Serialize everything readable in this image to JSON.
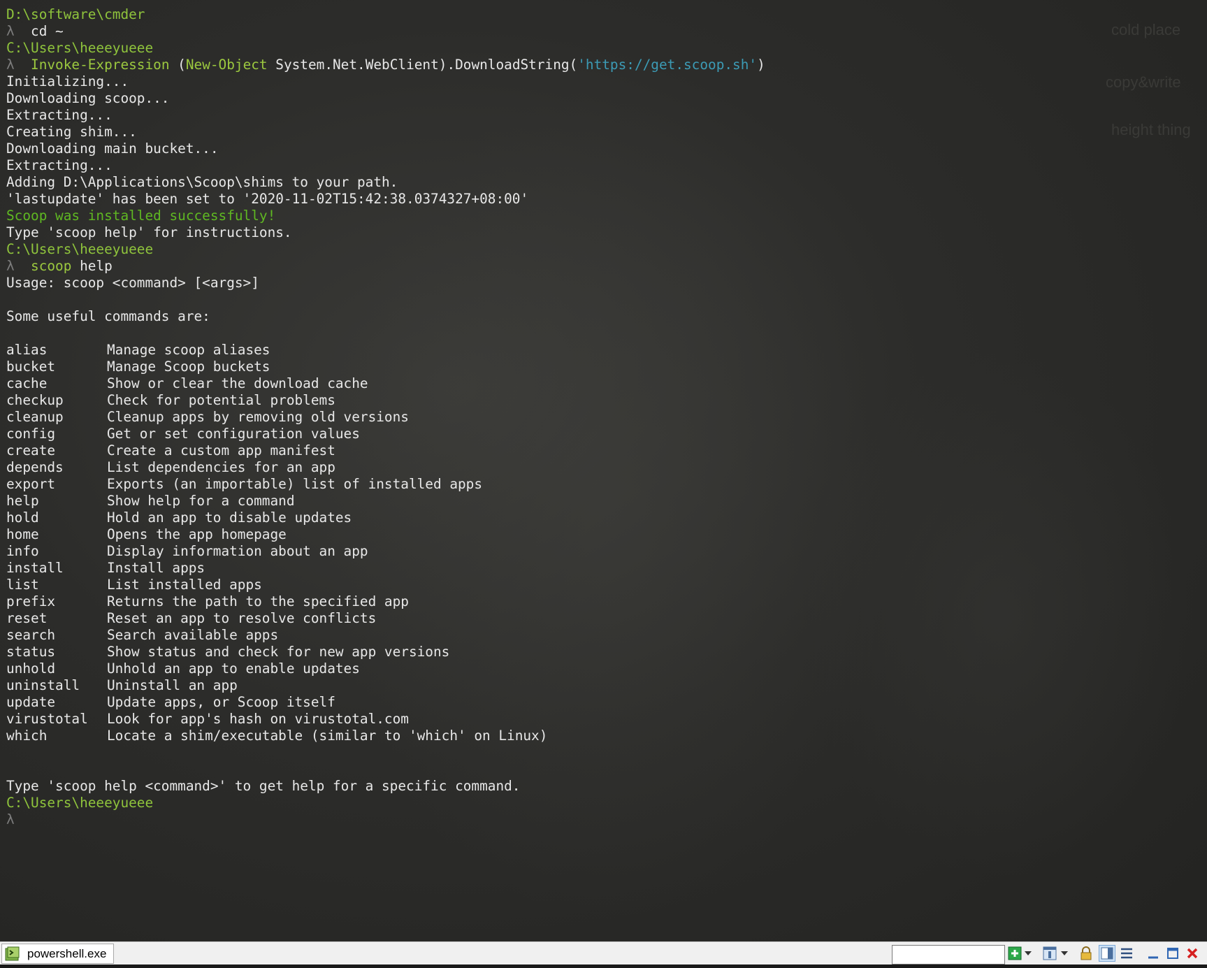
{
  "terminal": {
    "lines": [
      {
        "segments": [
          {
            "t": "D:\\software\\cmder",
            "c": "path"
          }
        ]
      },
      {
        "segments": [
          {
            "t": "λ",
            "c": "lambda"
          },
          {
            "t": "  cd ~",
            "c": ""
          }
        ]
      },
      {
        "segments": [
          {
            "t": "C:\\Users\\heeeyueee",
            "c": "path"
          }
        ]
      },
      {
        "segments": [
          {
            "t": "λ",
            "c": "lambda"
          },
          {
            "t": "  Invoke-Expression",
            "c": "kw"
          },
          {
            "t": " (",
            "c": ""
          },
          {
            "t": "New-Object",
            "c": "kw"
          },
          {
            "t": " System.Net.WebClient).DownloadString(",
            "c": ""
          },
          {
            "t": "'https://get.scoop.sh'",
            "c": "str"
          },
          {
            "t": ")",
            "c": ""
          }
        ]
      },
      {
        "segments": [
          {
            "t": "Initializing...",
            "c": ""
          }
        ]
      },
      {
        "segments": [
          {
            "t": "Downloading scoop...",
            "c": ""
          }
        ]
      },
      {
        "segments": [
          {
            "t": "Extracting...",
            "c": ""
          }
        ]
      },
      {
        "segments": [
          {
            "t": "Creating shim...",
            "c": ""
          }
        ]
      },
      {
        "segments": [
          {
            "t": "Downloading main bucket...",
            "c": ""
          }
        ]
      },
      {
        "segments": [
          {
            "t": "Extracting...",
            "c": ""
          }
        ]
      },
      {
        "segments": [
          {
            "t": "Adding D:\\Applications\\Scoop\\shims to your path.",
            "c": ""
          }
        ]
      },
      {
        "segments": [
          {
            "t": "'lastupdate' has been set to '2020-11-02T15:42:38.0374327+08:00'",
            "c": ""
          }
        ]
      },
      {
        "segments": [
          {
            "t": "Scoop was installed successfully!",
            "c": "success"
          }
        ]
      },
      {
        "segments": [
          {
            "t": "Type 'scoop help' for instructions.",
            "c": ""
          }
        ]
      },
      {
        "segments": [
          {
            "t": "C:\\Users\\heeeyueee",
            "c": "path"
          }
        ]
      },
      {
        "segments": [
          {
            "t": "λ",
            "c": "lambda"
          },
          {
            "t": "  scoop",
            "c": "kw"
          },
          {
            "t": " help",
            "c": ""
          }
        ]
      },
      {
        "segments": [
          {
            "t": "Usage: scoop <command> [<args>]",
            "c": ""
          }
        ]
      },
      {
        "segments": []
      },
      {
        "segments": [
          {
            "t": "Some useful commands are:",
            "c": ""
          }
        ]
      },
      {
        "segments": []
      }
    ],
    "commands": [
      {
        "name": "alias",
        "desc": "Manage scoop aliases"
      },
      {
        "name": "bucket",
        "desc": "Manage Scoop buckets"
      },
      {
        "name": "cache",
        "desc": "Show or clear the download cache"
      },
      {
        "name": "checkup",
        "desc": "Check for potential problems"
      },
      {
        "name": "cleanup",
        "desc": "Cleanup apps by removing old versions"
      },
      {
        "name": "config",
        "desc": "Get or set configuration values"
      },
      {
        "name": "create",
        "desc": "Create a custom app manifest"
      },
      {
        "name": "depends",
        "desc": "List dependencies for an app"
      },
      {
        "name": "export",
        "desc": "Exports (an importable) list of installed apps"
      },
      {
        "name": "help",
        "desc": "Show help for a command"
      },
      {
        "name": "hold",
        "desc": "Hold an app to disable updates"
      },
      {
        "name": "home",
        "desc": "Opens the app homepage"
      },
      {
        "name": "info",
        "desc": "Display information about an app"
      },
      {
        "name": "install",
        "desc": "Install apps"
      },
      {
        "name": "list",
        "desc": "List installed apps"
      },
      {
        "name": "prefix",
        "desc": "Returns the path to the specified app"
      },
      {
        "name": "reset",
        "desc": "Reset an app to resolve conflicts"
      },
      {
        "name": "search",
        "desc": "Search available apps"
      },
      {
        "name": "status",
        "desc": "Show status and check for new app versions"
      },
      {
        "name": "unhold",
        "desc": "Unhold an app to enable updates"
      },
      {
        "name": "uninstall",
        "desc": "Uninstall an app"
      },
      {
        "name": "update",
        "desc": "Update apps, or Scoop itself"
      },
      {
        "name": "virustotal",
        "desc": "Look for app's hash on virustotal.com"
      },
      {
        "name": "which",
        "desc": "Locate a shim/executable (similar to 'which' on Linux)"
      }
    ],
    "footer_lines": [
      {
        "segments": []
      },
      {
        "segments": []
      },
      {
        "segments": [
          {
            "t": "Type 'scoop help <command>' to get help for a specific command.",
            "c": ""
          }
        ]
      },
      {
        "segments": [
          {
            "t": "C:\\Users\\heeeyueee",
            "c": "path"
          }
        ]
      },
      {
        "segments": [
          {
            "t": "λ",
            "c": "lambda"
          }
        ]
      }
    ]
  },
  "background_text": {
    "cold_place": "cold place",
    "copy_write": "copy&write",
    "height_thing": "height thing"
  },
  "statusbar": {
    "tab_label": "powershell.exe",
    "search_value": "",
    "icons": [
      "new-console-icon",
      "dropdown-icon",
      "view-icon",
      "dropdown-icon",
      "lock-icon",
      "split-view-icon",
      "menu-icon",
      "minimize-icon",
      "maximize-icon",
      "close-icon"
    ]
  },
  "colors": {
    "path": "#8fc43c",
    "lambda": "#7c7c7c",
    "keyword": "#9cc93f",
    "string": "#3c9bb5",
    "success": "#5fb822",
    "text": "#e8e8e8",
    "background": "#2c2c2a"
  }
}
